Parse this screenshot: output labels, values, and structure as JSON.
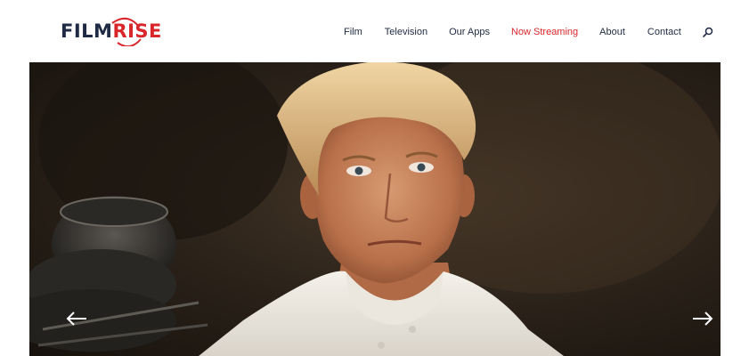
{
  "brand": {
    "logo_part1": "FILM",
    "logo_part2": "RISE"
  },
  "nav": {
    "items": [
      {
        "label": "Film"
      },
      {
        "label": "Television"
      },
      {
        "label": "Our Apps"
      },
      {
        "label": "Now Streaming",
        "active": true
      },
      {
        "label": "About"
      },
      {
        "label": "Contact"
      }
    ],
    "search_icon": "search-icon"
  },
  "hero": {
    "image": "chef-portrait-banner",
    "prev_icon": "arrow-left-icon",
    "next_icon": "arrow-right-icon"
  },
  "colors": {
    "brand_navy": "#1f2a44",
    "brand_red": "#d9262b"
  }
}
